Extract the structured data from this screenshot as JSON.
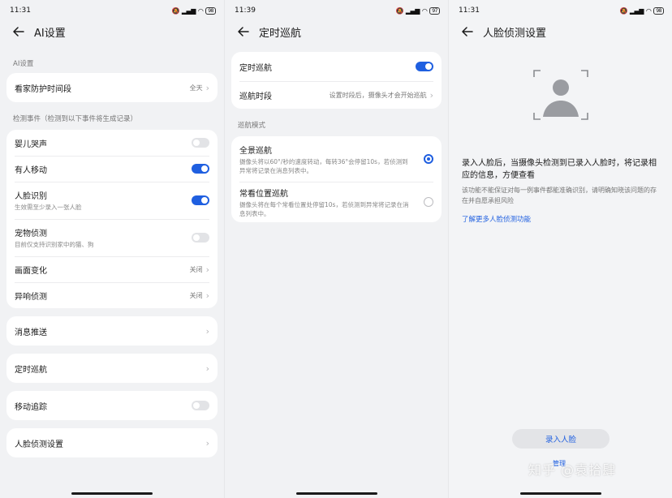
{
  "colors": {
    "accent": "#1f5fe0",
    "background": "#f1f2f4",
    "card": "#ffffff"
  },
  "screen1": {
    "status": {
      "time": "11:31",
      "battery": "98"
    },
    "title": "AI设置",
    "section1_label": "AI设置",
    "home_protect": {
      "label": "看家防护时间段",
      "value": "全天"
    },
    "section2_label": "检测事件（检测到以下事件将生成记录）",
    "events": {
      "baby": {
        "label": "婴儿哭声"
      },
      "person": {
        "label": "有人移动"
      },
      "face": {
        "label": "人脸识别",
        "sub": "生效需至少录入一张人脸"
      },
      "pet": {
        "label": "宠物侦测",
        "sub": "目前仅支持识别家中的猫、狗"
      },
      "scene": {
        "label": "画面变化",
        "value": "关闭"
      },
      "sound": {
        "label": "异响侦测",
        "value": "关闭"
      }
    },
    "push": {
      "label": "消息推送"
    },
    "cruise": {
      "label": "定时巡航"
    },
    "tracking": {
      "label": "移动追踪"
    },
    "face_settings": {
      "label": "人脸侦测设置"
    }
  },
  "screen2": {
    "status": {
      "time": "11:39",
      "battery": "97"
    },
    "title": "定时巡航",
    "cruise_toggle": {
      "label": "定时巡航"
    },
    "cruise_period": {
      "label": "巡航时段",
      "value": "设置时段后，摄像头才会开始巡航"
    },
    "mode_label": "巡航模式",
    "modes": {
      "panorama": {
        "label": "全景巡航",
        "desc": "摄像头将以60°/秒的速度转动，每转36°会停留10s，若侦测到异常将记录在消息列表中。"
      },
      "positions": {
        "label": "常看位置巡航",
        "desc": "摄像头将在每个常看位置处停留10s，若侦测到异常将记录在消息列表中。"
      }
    }
  },
  "screen3": {
    "status": {
      "time": "11:31",
      "battery": "98"
    },
    "title": "人脸侦测设置",
    "desc_title": "录入人脸后，当摄像头检测到已录入人脸时，将记录相应的信息，方便查看",
    "desc_body": "该功能不能保证对每一例事件都能准确识别，请明确知晓该问题的存在并自愿承担风险",
    "learn_more": "了解更多人脸侦测功能",
    "enroll_button": "录入人脸",
    "manage_link": "管理",
    "watermark": "知乎 @袁拾肆"
  }
}
